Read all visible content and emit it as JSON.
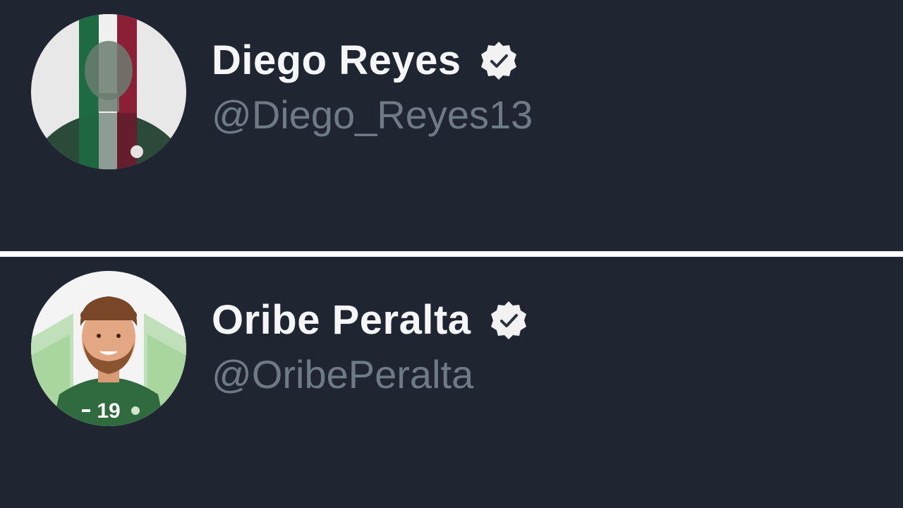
{
  "profiles": [
    {
      "name": "Diego Reyes",
      "handle": "@Diego_Reyes13",
      "verified": true,
      "avatar_icon": "player-photo-avatar"
    },
    {
      "name": "Oribe Peralta",
      "handle": "@OribePeralta",
      "verified": true,
      "avatar_icon": "player-illustration-avatar",
      "jersey_number": "19"
    }
  ],
  "colors": {
    "panel_bg": "#1f2631",
    "divider": "#ffffff",
    "name_text": "#f5f6f7",
    "handle_text": "#6f7a87",
    "badge": "#f2f2f2"
  }
}
